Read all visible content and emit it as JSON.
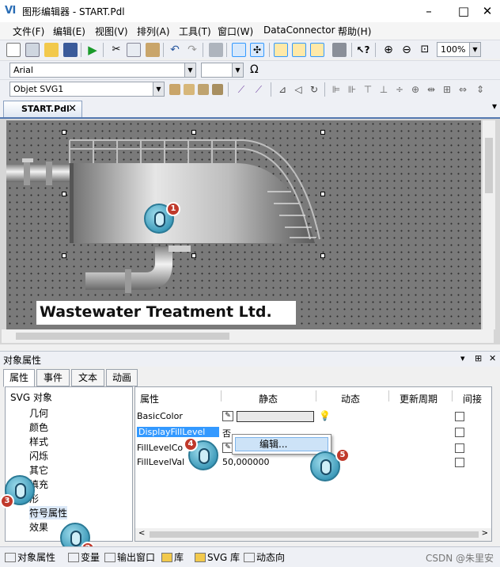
{
  "window": {
    "app_icon": "app-logo-icon",
    "title": "图形编辑器 - START.Pdl",
    "min": "–",
    "max": "□",
    "close": "✕"
  },
  "menu": [
    "文件(F)",
    "编辑(E)",
    "视图(V)",
    "排列(A)",
    "工具(T)",
    "窗口(W)",
    "DataConnector",
    "帮助(H)"
  ],
  "toolbar": {
    "zoom": "100%"
  },
  "font_bar": {
    "font": "Arial",
    "omega": "Ω"
  },
  "object_bar": {
    "object": "Objet SVG1"
  },
  "document_tab": {
    "label": "START.Pdl",
    "close": "✕"
  },
  "canvas": {
    "banner": "Wastewater Treatment Ltd."
  },
  "callouts": [
    "1",
    "2",
    "3",
    "4",
    "5"
  ],
  "panel": {
    "title": "对象属性",
    "buttons": [
      "▾",
      "⊞",
      "✕"
    ],
    "tabs": [
      "属性",
      "事件",
      "文本",
      "动画"
    ],
    "tree": [
      "SVG 对象",
      "几何",
      "颜色",
      "样式",
      "闪烁",
      "其它",
      "填充",
      "形",
      "符号属性",
      "效果"
    ],
    "columns": [
      "属性",
      "静态",
      "动态",
      "更新周期",
      "间接"
    ],
    "rows": [
      {
        "name": "BasicColor",
        "static": ""
      },
      {
        "name": "DisplayFillLevel",
        "static": "否"
      },
      {
        "name": "FillLevelCo",
        "static": ""
      },
      {
        "name": "FillLevelVal",
        "static": "50,000000"
      }
    ],
    "context_menu": "编辑..."
  },
  "bottom_tabs": [
    "对象属性",
    "变量",
    "输出窗口",
    "库",
    "SVG 库",
    "动态向"
  ],
  "watermark": "CSDN @朱里安",
  "colors": {
    "accent": "#5478b0",
    "selection": "#3399ff",
    "callout": "#3a98b8",
    "badge": "#c0392b"
  }
}
